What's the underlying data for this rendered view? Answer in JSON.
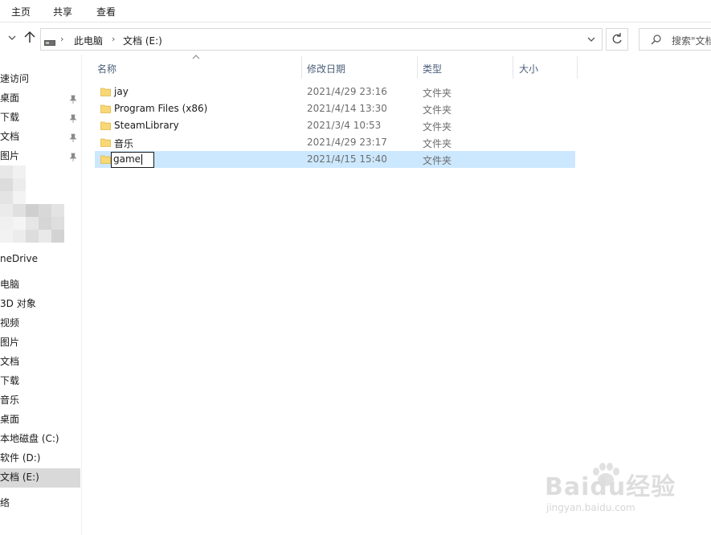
{
  "ribbon": {
    "tabs": [
      "主页",
      "共享",
      "查看"
    ]
  },
  "address": {
    "crumbs": [
      "此电脑",
      "文档 (E:)"
    ],
    "search_placeholder": "搜索\"文档"
  },
  "sidebar": {
    "items": [
      {
        "label": "速访问"
      },
      {
        "label": "桌面",
        "pinned": true
      },
      {
        "label": "下载",
        "pinned": true
      },
      {
        "label": "文档",
        "pinned": true
      },
      {
        "label": "图片",
        "pinned": true
      },
      {
        "label": "neDrive"
      },
      {
        "label": "电脑"
      },
      {
        "label": "3D 对象"
      },
      {
        "label": "视频"
      },
      {
        "label": "图片"
      },
      {
        "label": "文档"
      },
      {
        "label": "下载"
      },
      {
        "label": "音乐"
      },
      {
        "label": "桌面"
      },
      {
        "label": "本地磁盘 (C:)"
      },
      {
        "label": "软件 (D:)"
      },
      {
        "label": "文档 (E:)",
        "selected": true
      },
      {
        "label": "络"
      }
    ]
  },
  "columns": {
    "name": "名称",
    "date": "修改日期",
    "type": "类型",
    "size": "大小"
  },
  "files": [
    {
      "name": "jay",
      "date": "2021/4/29 23:16",
      "type": "文件夹"
    },
    {
      "name": "Program Files (x86)",
      "date": "2021/4/14 13:30",
      "type": "文件夹"
    },
    {
      "name": "SteamLibrary",
      "date": "2021/3/4 10:53",
      "type": "文件夹"
    },
    {
      "name": "音乐",
      "date": "2021/4/29 23:17",
      "type": "文件夹"
    },
    {
      "name": "game",
      "date": "2021/4/15 15:40",
      "type": "文件夹",
      "renaming": true
    }
  ],
  "watermark": {
    "brand": "Baidu经验",
    "url": "jingyan.baidu.com"
  },
  "colors": {
    "selected_row": "#cce8ff",
    "selected_side": "#d9d9d9",
    "folder": "#f8d775",
    "header_text": "#4c607a"
  }
}
